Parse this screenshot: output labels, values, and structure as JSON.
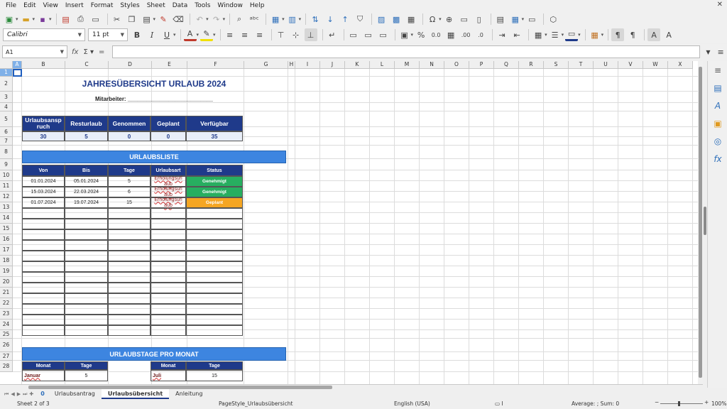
{
  "menu": [
    "File",
    "Edit",
    "View",
    "Insert",
    "Format",
    "Styles",
    "Sheet",
    "Data",
    "Tools",
    "Window",
    "Help"
  ],
  "font": {
    "name": "Calibri",
    "size": "11 pt"
  },
  "namebox": "A1",
  "columns": [
    "A",
    "B",
    "C",
    "D",
    "E",
    "F",
    "G",
    "H",
    "I",
    "J",
    "K",
    "L",
    "M",
    "N",
    "O",
    "P",
    "Q",
    "R",
    "S",
    "T",
    "U",
    "V",
    "W",
    "X"
  ],
  "rows": [
    "1",
    "2",
    "3",
    "4",
    "5",
    "6",
    "7",
    "8",
    "9",
    "10",
    "11",
    "12",
    "13",
    "14",
    "15",
    "16",
    "17",
    "18",
    "19",
    "20",
    "21",
    "22",
    "23",
    "24",
    "25",
    "26",
    "27",
    "28"
  ],
  "sheet": {
    "title": "JAHRESÜBERSICHT URLAUB 2024",
    "mitarbeiter": "Mitarbeiter: ___________________________",
    "summary_headers": [
      "Urlaubsansp ruch",
      "Resturlaub",
      "Genommen",
      "Geplant",
      "Verfügbar"
    ],
    "summary_values": [
      "30",
      "5",
      "0",
      "0",
      "35"
    ],
    "list_title": "URLAUBSLISTE",
    "list_headers": [
      "Von",
      "Bis",
      "Tage",
      "Urlaubsart",
      "Status"
    ],
    "list_rows": [
      {
        "von": "01.01.2024",
        "bis": "05.01.2024",
        "tage": "5",
        "art": "Erholungsurl aub",
        "status": "Genehmigt"
      },
      {
        "von": "15.03.2024",
        "bis": "22.03.2024",
        "tage": "6",
        "art": "Erholungsurl aub",
        "status": "Genehmigt"
      },
      {
        "von": "01.07.2024",
        "bis": "19.07.2024",
        "tage": "15",
        "art": "Erholungsurl aub",
        "status": "Geplant"
      }
    ],
    "monthly_title": "URLAUBSTAGE PRO MONAT",
    "monthly_headers": [
      "Monat",
      "Tage",
      "Monat",
      "Tage"
    ],
    "monthly_row": [
      "Januar",
      "5",
      "Juli",
      "15"
    ]
  },
  "tabs": {
    "count": "0",
    "items": [
      "Urlaubsantrag",
      "Urlaubsübersicht",
      "Anleitung"
    ],
    "active": "Urlaubsübersicht"
  },
  "status": {
    "sheet": "Sheet 2 of 3",
    "pagestyle": "PageStyle_Urlaubsübersicht",
    "language": "English (USA)",
    "sum": "Average: ; Sum: 0",
    "zoom": "100%"
  },
  "colors": {
    "navy": "#1f3a8a",
    "blue": "#3d85e0",
    "green": "#27ae60",
    "orange": "#f5a623"
  }
}
